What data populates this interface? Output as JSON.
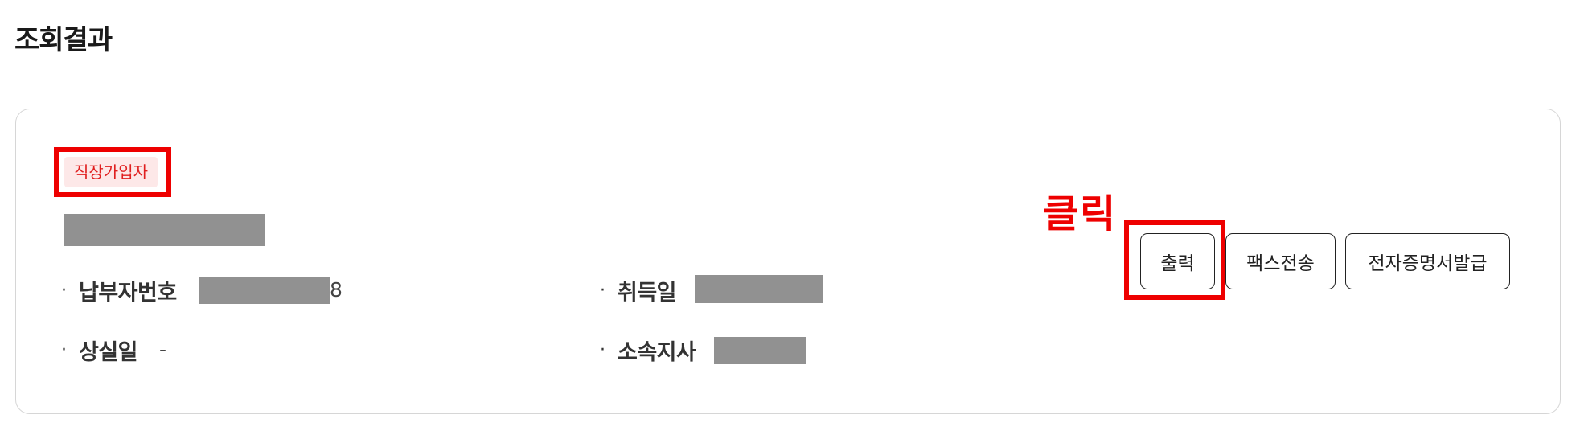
{
  "page": {
    "title": "조회결과"
  },
  "card": {
    "badge": "직장가입자",
    "fields": {
      "taxpayer_number": {
        "label": "납부자번호",
        "value_prefix": "-",
        "value_suffix": "8"
      },
      "acquisition_date": {
        "label": "취득일"
      },
      "loss_date": {
        "label": "상실일",
        "value": "-"
      },
      "branch": {
        "label": "소속지사"
      }
    },
    "buttons": {
      "print": "출력",
      "fax": "팩스전송",
      "e_certificate": "전자증명서발급"
    }
  },
  "annotation": {
    "click_label": "클릭",
    "color": "#ee0000"
  },
  "colors": {
    "badge_bg": "#fde8e8",
    "badge_text": "#e02020",
    "redaction": "#919191"
  }
}
